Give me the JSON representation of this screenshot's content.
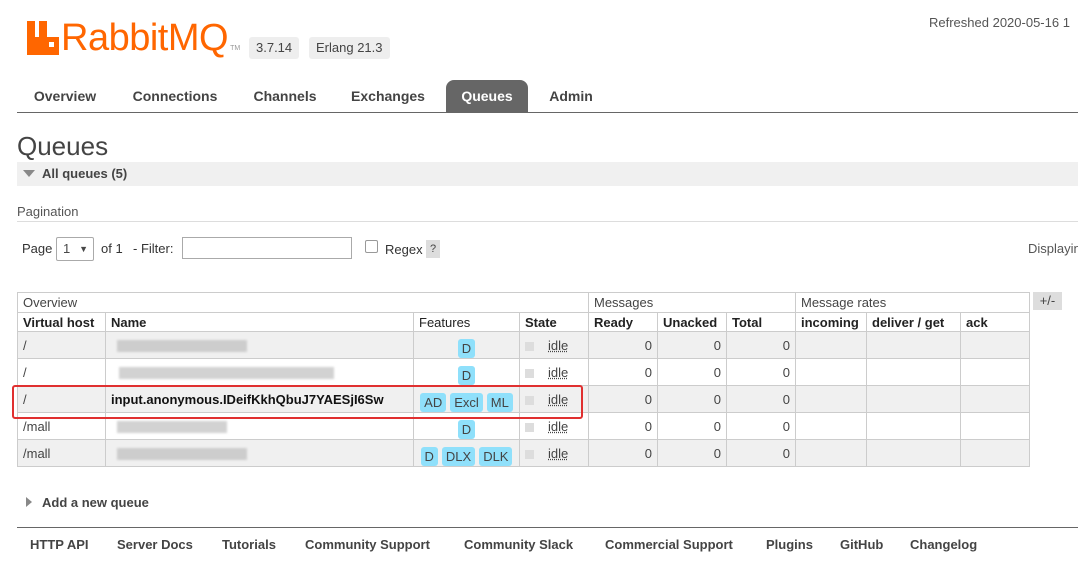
{
  "brand": {
    "name": "RabbitMQ",
    "tm": "TM",
    "color": "#ff6600",
    "icon": "rabbitmq-logo-icon"
  },
  "versions": {
    "rabbitmq": "3.7.14",
    "erlang": "Erlang 21.3"
  },
  "refreshed": "Refreshed 2020-05-16 1",
  "nav": {
    "tabs": [
      "Overview",
      "Connections",
      "Channels",
      "Exchanges",
      "Queues",
      "Admin"
    ],
    "active": "Queues"
  },
  "page_title": "Queues",
  "all_queues": "All queues (5)",
  "pagination": {
    "label": "Pagination",
    "page_label": "Page",
    "page_value": "1",
    "of_label": "of 1",
    "filter_label": "- Filter:",
    "filter_value": "",
    "regex_label": "Regex",
    "help": "?",
    "displaying": "Displayin"
  },
  "table": {
    "groups": [
      "Overview",
      "Messages",
      "Message rates"
    ],
    "headers": [
      "Virtual host",
      "Name",
      "Features",
      "State",
      "Ready",
      "Unacked",
      "Total",
      "incoming",
      "deliver / get",
      "ack"
    ],
    "toggle": "+/-",
    "rows": [
      {
        "vhost": "/",
        "name": "",
        "features": [
          "D"
        ],
        "state": "idle",
        "ready": "0",
        "unacked": "0",
        "total": "0"
      },
      {
        "vhost": "/",
        "name": "",
        "features": [
          "D"
        ],
        "state": "idle",
        "ready": "0",
        "unacked": "0",
        "total": "0"
      },
      {
        "vhost": "/",
        "name": "input.anonymous.IDeifKkhQbuJ7YAESjI6Sw",
        "features": [
          "AD",
          "Excl",
          "ML"
        ],
        "state": "idle",
        "ready": "0",
        "unacked": "0",
        "total": "0"
      },
      {
        "vhost": "/mall",
        "name": "",
        "features": [
          "D"
        ],
        "state": "idle",
        "ready": "0",
        "unacked": "0",
        "total": "0"
      },
      {
        "vhost": "/mall",
        "name": "",
        "features": [
          "D",
          "DLX",
          "DLK"
        ],
        "state": "idle",
        "ready": "0",
        "unacked": "0",
        "total": "0"
      }
    ]
  },
  "add_queue": "Add a new queue",
  "footer": [
    "HTTP API",
    "Server Docs",
    "Tutorials",
    "Community Support",
    "Community Slack",
    "Commercial Support",
    "Plugins",
    "GitHub",
    "Changelog"
  ]
}
